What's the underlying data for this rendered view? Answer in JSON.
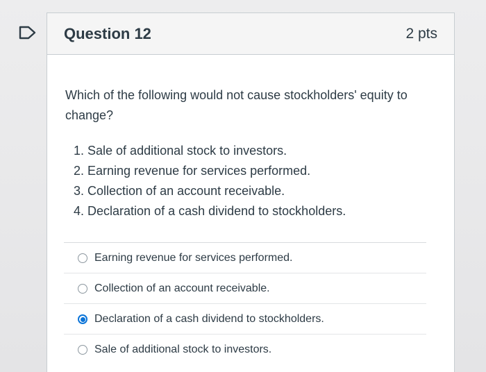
{
  "question": {
    "title": "Question 12",
    "points": "2 pts",
    "text": "Which of the following would not cause stockholders' equity to change?",
    "items": [
      "1. Sale of additional stock to investors.",
      "2. Earning revenue for services performed.",
      "3. Collection of an account receivable.",
      "4. Declaration of a cash dividend to stockholders."
    ]
  },
  "answers": [
    {
      "label": "Earning revenue for services performed.",
      "selected": false
    },
    {
      "label": "Collection of an account receivable.",
      "selected": false
    },
    {
      "label": "Declaration of a cash dividend to stockholders.",
      "selected": true
    },
    {
      "label": "Sale of additional stock to investors.",
      "selected": false
    }
  ],
  "colors": {
    "accent": "#0b74d8",
    "text": "#2d3b45",
    "header_bg": "#f5f5f5"
  },
  "icons": {
    "flag": "flag-question-icon"
  }
}
